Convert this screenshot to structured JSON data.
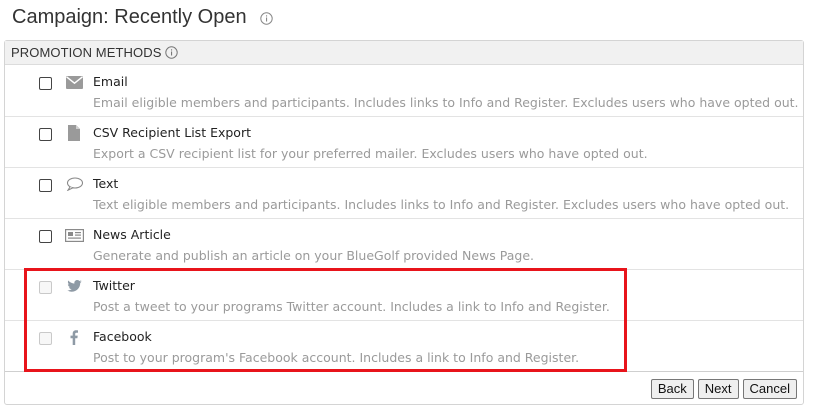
{
  "header": {
    "title": "Campaign: Recently Open",
    "info_icon": "info-circle-icon"
  },
  "panel": {
    "title": "PROMOTION METHODS",
    "info_icon": "info-circle-icon"
  },
  "methods": [
    {
      "label": "Email",
      "description": "Email eligible members and participants. Includes links to Info and Register. Excludes users who have opted out.",
      "icon": "envelope-icon",
      "checked": false,
      "enabled": true
    },
    {
      "label": "CSV Recipient List Export",
      "description": "Export a CSV recipient list for your preferred mailer. Excludes users who have opted out.",
      "icon": "file-icon",
      "checked": false,
      "enabled": true
    },
    {
      "label": "Text",
      "description": "Text eligible members and participants. Includes links to Info and Register. Excludes users who have opted out.",
      "icon": "speech-bubble-icon",
      "checked": false,
      "enabled": true
    },
    {
      "label": "News Article",
      "description": "Generate and publish an article on your BlueGolf provided News Page.",
      "icon": "newspaper-icon",
      "checked": false,
      "enabled": true
    },
    {
      "label": "Twitter",
      "description": "Post a tweet to your programs Twitter account. Includes a link to Info and Register.",
      "icon": "twitter-bird-icon",
      "checked": false,
      "enabled": false
    },
    {
      "label": "Facebook",
      "description": "Post to your program's Facebook account. Includes a link to Info and Register.",
      "icon": "facebook-f-icon",
      "checked": false,
      "enabled": false
    }
  ],
  "highlight_color": "#e8141b",
  "buttons": {
    "back": "Back",
    "next": "Next",
    "cancel": "Cancel"
  }
}
